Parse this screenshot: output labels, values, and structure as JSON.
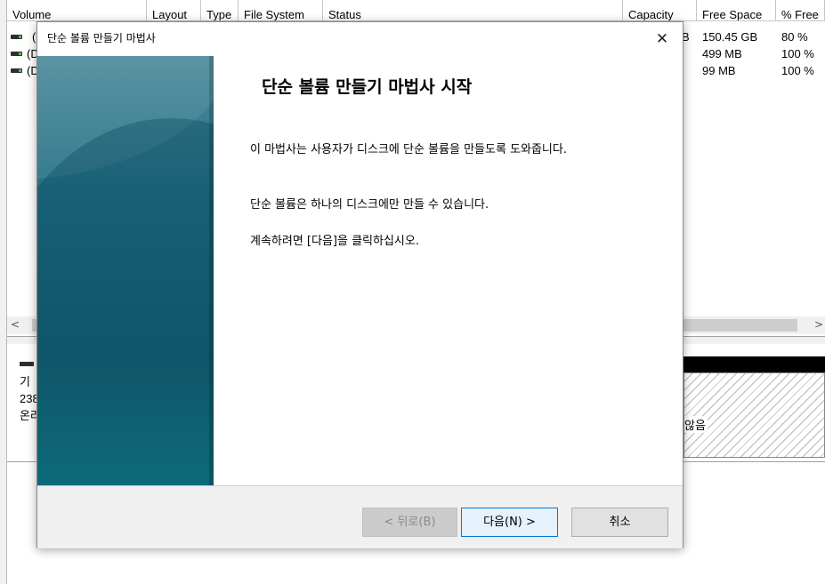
{
  "volume_table": {
    "columns": [
      "Volume",
      "Layout",
      "Type",
      "File System",
      "Status",
      "Capacity",
      "Free Space",
      "% Free"
    ],
    "rows": [
      {
        "volume": "(",
        "capacity": "B",
        "free": "150.45 GB",
        "pct": "80 %"
      },
      {
        "volume": "(D",
        "capacity": "",
        "free": "499 MB",
        "pct": "100 %"
      },
      {
        "volume": "(D",
        "capacity": "",
        "free": "99 MB",
        "pct": "100 %"
      }
    ],
    "scroll_left": "<",
    "scroll_right": ">"
  },
  "disk_panel": {
    "info_line1": "기",
    "info_line2": "238",
    "info_line3": "온라",
    "unallocated_label": "않음"
  },
  "dialog": {
    "title": "단순 볼륨 만들기 마법사",
    "close_glyph": "✕",
    "heading": "단순 볼륨 만들기 마법사 시작",
    "paragraph1": "이 마법사는 사용자가 디스크에 단순 볼륨을 만들도록 도와줍니다.",
    "paragraph2": "단순 볼륨은 하나의 디스크에만 만들 수 있습니다.",
    "paragraph3": "계속하려면 [다음]을 클릭하십시오.",
    "buttons": {
      "back": "< 뒤로(B)",
      "next": "다음(N) >",
      "cancel": "취소"
    }
  },
  "colors": {
    "banner_top": "#4d8a9a",
    "banner_bottom": "#0f7f8a",
    "focus_border": "#0078d7"
  }
}
